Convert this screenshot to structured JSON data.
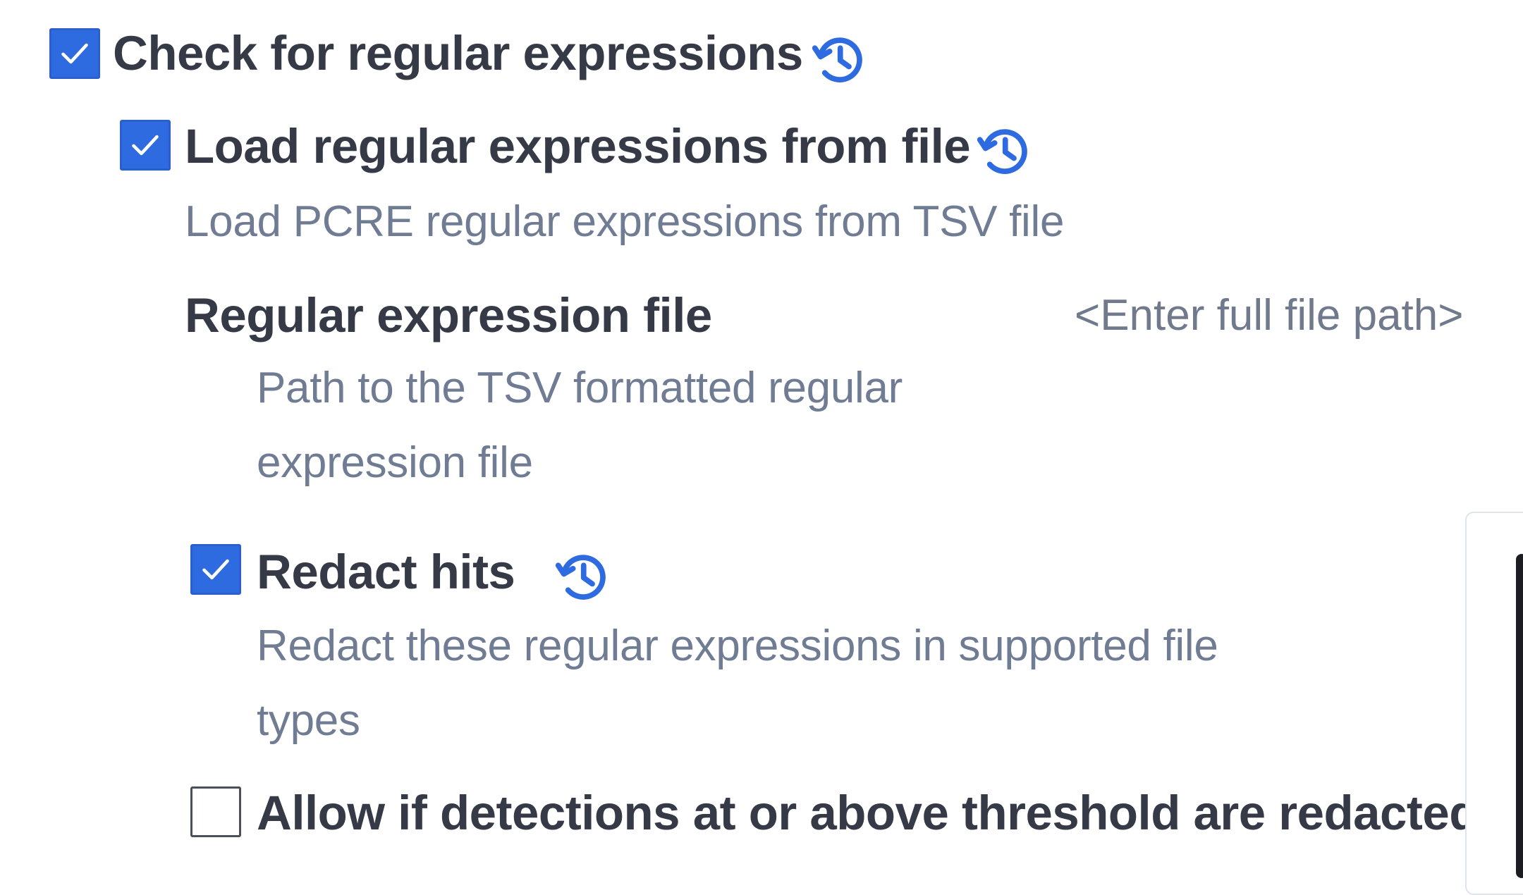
{
  "settings": {
    "regex_check": {
      "label": "Check for regular expressions",
      "checked": true,
      "history_icon": "history-icon"
    },
    "load_from_file": {
      "label": "Load regular expressions from file",
      "description": "Load PCRE regular expressions from TSV file",
      "checked": true,
      "history_icon": "history-icon"
    },
    "regex_file": {
      "label": "Regular expression file",
      "placeholder": "<Enter full file path>",
      "description_lines": [
        "Path to the TSV formatted regular",
        "expression file"
      ]
    },
    "redact_hits": {
      "label": "Redact hits",
      "description_lines": [
        "Redact these regular expressions in supported file",
        "types"
      ],
      "checked": true,
      "history_icon": "history-icon"
    },
    "allow_redacted": {
      "label": "Allow if detections at or above threshold are redacted",
      "checked": false
    }
  },
  "colors": {
    "accent": "#2f6be0",
    "label": "#353a46",
    "description": "#6f7c93"
  }
}
